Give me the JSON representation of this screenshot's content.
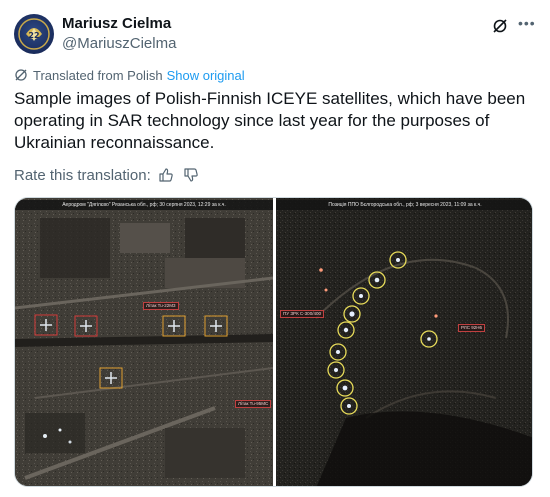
{
  "author": {
    "display_name": "Mariusz Cielma",
    "handle": "@MariuszCielma",
    "avatar_icon": "avatar-emblem"
  },
  "header": {
    "grok_icon": "grok-icon",
    "more_icon": "more-dots-icon"
  },
  "translation": {
    "label": "Translated from Polish",
    "show_original": "Show original"
  },
  "tweet": {
    "text": "Sample images of Polish-Finnish ICEYE satellites, which have been operating in SAR technology since last year for the purposes of Ukrainian reconnaissance."
  },
  "rating": {
    "label": "Rate this translation:",
    "thumbs_up_icon": "thumbs-up-icon",
    "thumbs_down_icon": "thumbs-down-icon"
  },
  "media": {
    "left": {
      "caption": "Аеродром \"Дягілєво\" Рязанська обл., рф; 30 серпня 2023, 12:29 за к.ч.",
      "tags": [
        "Літак Tu-22М3",
        "Літак Tu-95МС"
      ]
    },
    "right": {
      "caption": "Позиція ППО Бєлгородська обл., рф; 3 вересня 2023, 11:09 за к.ч.",
      "tags": [
        "ПУ ЗРК С-300/400",
        "РЛС 92Н6"
      ]
    }
  },
  "colors": {
    "link": "#1d9bf0",
    "text": "#0f1419",
    "secondary": "#536471"
  }
}
